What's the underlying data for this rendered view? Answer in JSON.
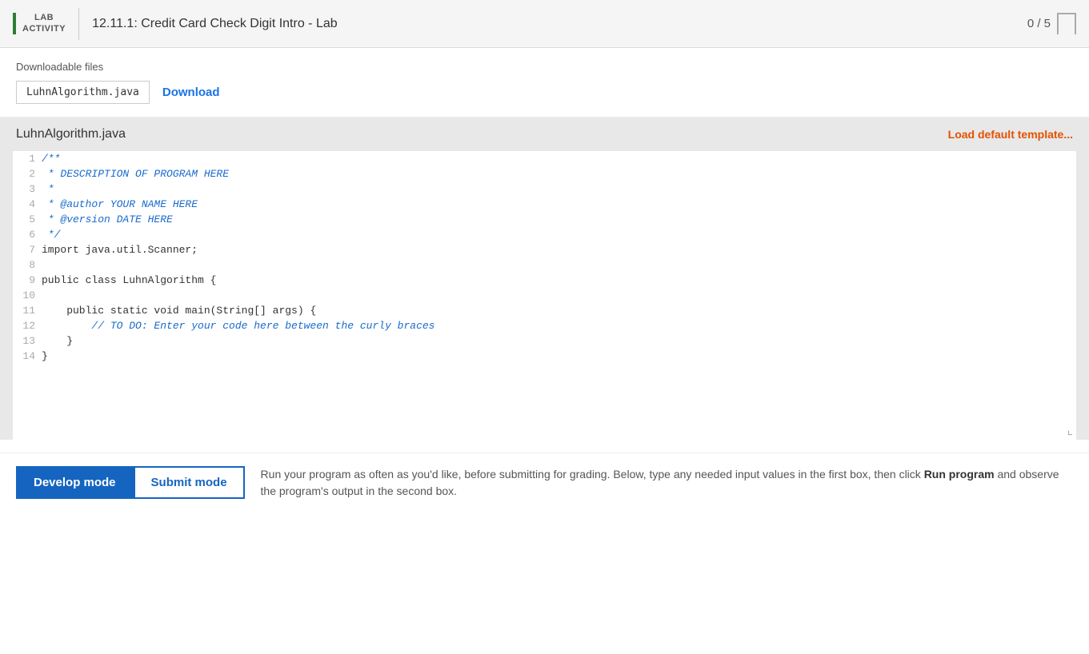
{
  "header": {
    "lab_line1": "LAB",
    "lab_line2": "ACTIVITY",
    "title": "12.11.1: Credit Card Check Digit Intro - Lab",
    "score": "0 / 5"
  },
  "downloadable": {
    "section_label": "Downloadable files",
    "file_name": "LuhnAlgorithm.java",
    "download_label": "Download"
  },
  "code_editor": {
    "file_title": "LuhnAlgorithm.java",
    "load_template_label": "Load default template...",
    "lines": [
      {
        "num": "1",
        "content": "/**",
        "type": "comment"
      },
      {
        "num": "2",
        "content": " * DESCRIPTION OF PROGRAM HERE",
        "type": "comment"
      },
      {
        "num": "3",
        "content": " *",
        "type": "comment"
      },
      {
        "num": "4",
        "content": " * @author YOUR NAME HERE",
        "type": "comment"
      },
      {
        "num": "5",
        "content": " * @version DATE HERE",
        "type": "comment"
      },
      {
        "num": "6",
        "content": " */",
        "type": "comment"
      },
      {
        "num": "7",
        "content": "import java.util.Scanner;",
        "type": "code"
      },
      {
        "num": "8",
        "content": "",
        "type": "code"
      },
      {
        "num": "9",
        "content": "public class LuhnAlgorithm {",
        "type": "code"
      },
      {
        "num": "10",
        "content": "",
        "type": "code"
      },
      {
        "num": "11",
        "content": "    public static void main(String[] args) {",
        "type": "code"
      },
      {
        "num": "12",
        "content": "        // TO DO: Enter your code here between the curly braces",
        "type": "inline-comment"
      },
      {
        "num": "13",
        "content": "    }",
        "type": "code"
      },
      {
        "num": "14",
        "content": "}",
        "type": "code"
      }
    ]
  },
  "bottom_bar": {
    "develop_btn_label": "Develop mode",
    "submit_btn_label": "Submit mode",
    "description": "Run your program as often as you'd like, before submitting for grading. Below, type any needed input values in the first box, then click ",
    "bold_part": "Run program",
    "description_end": " and observe the program's output in the second box."
  }
}
